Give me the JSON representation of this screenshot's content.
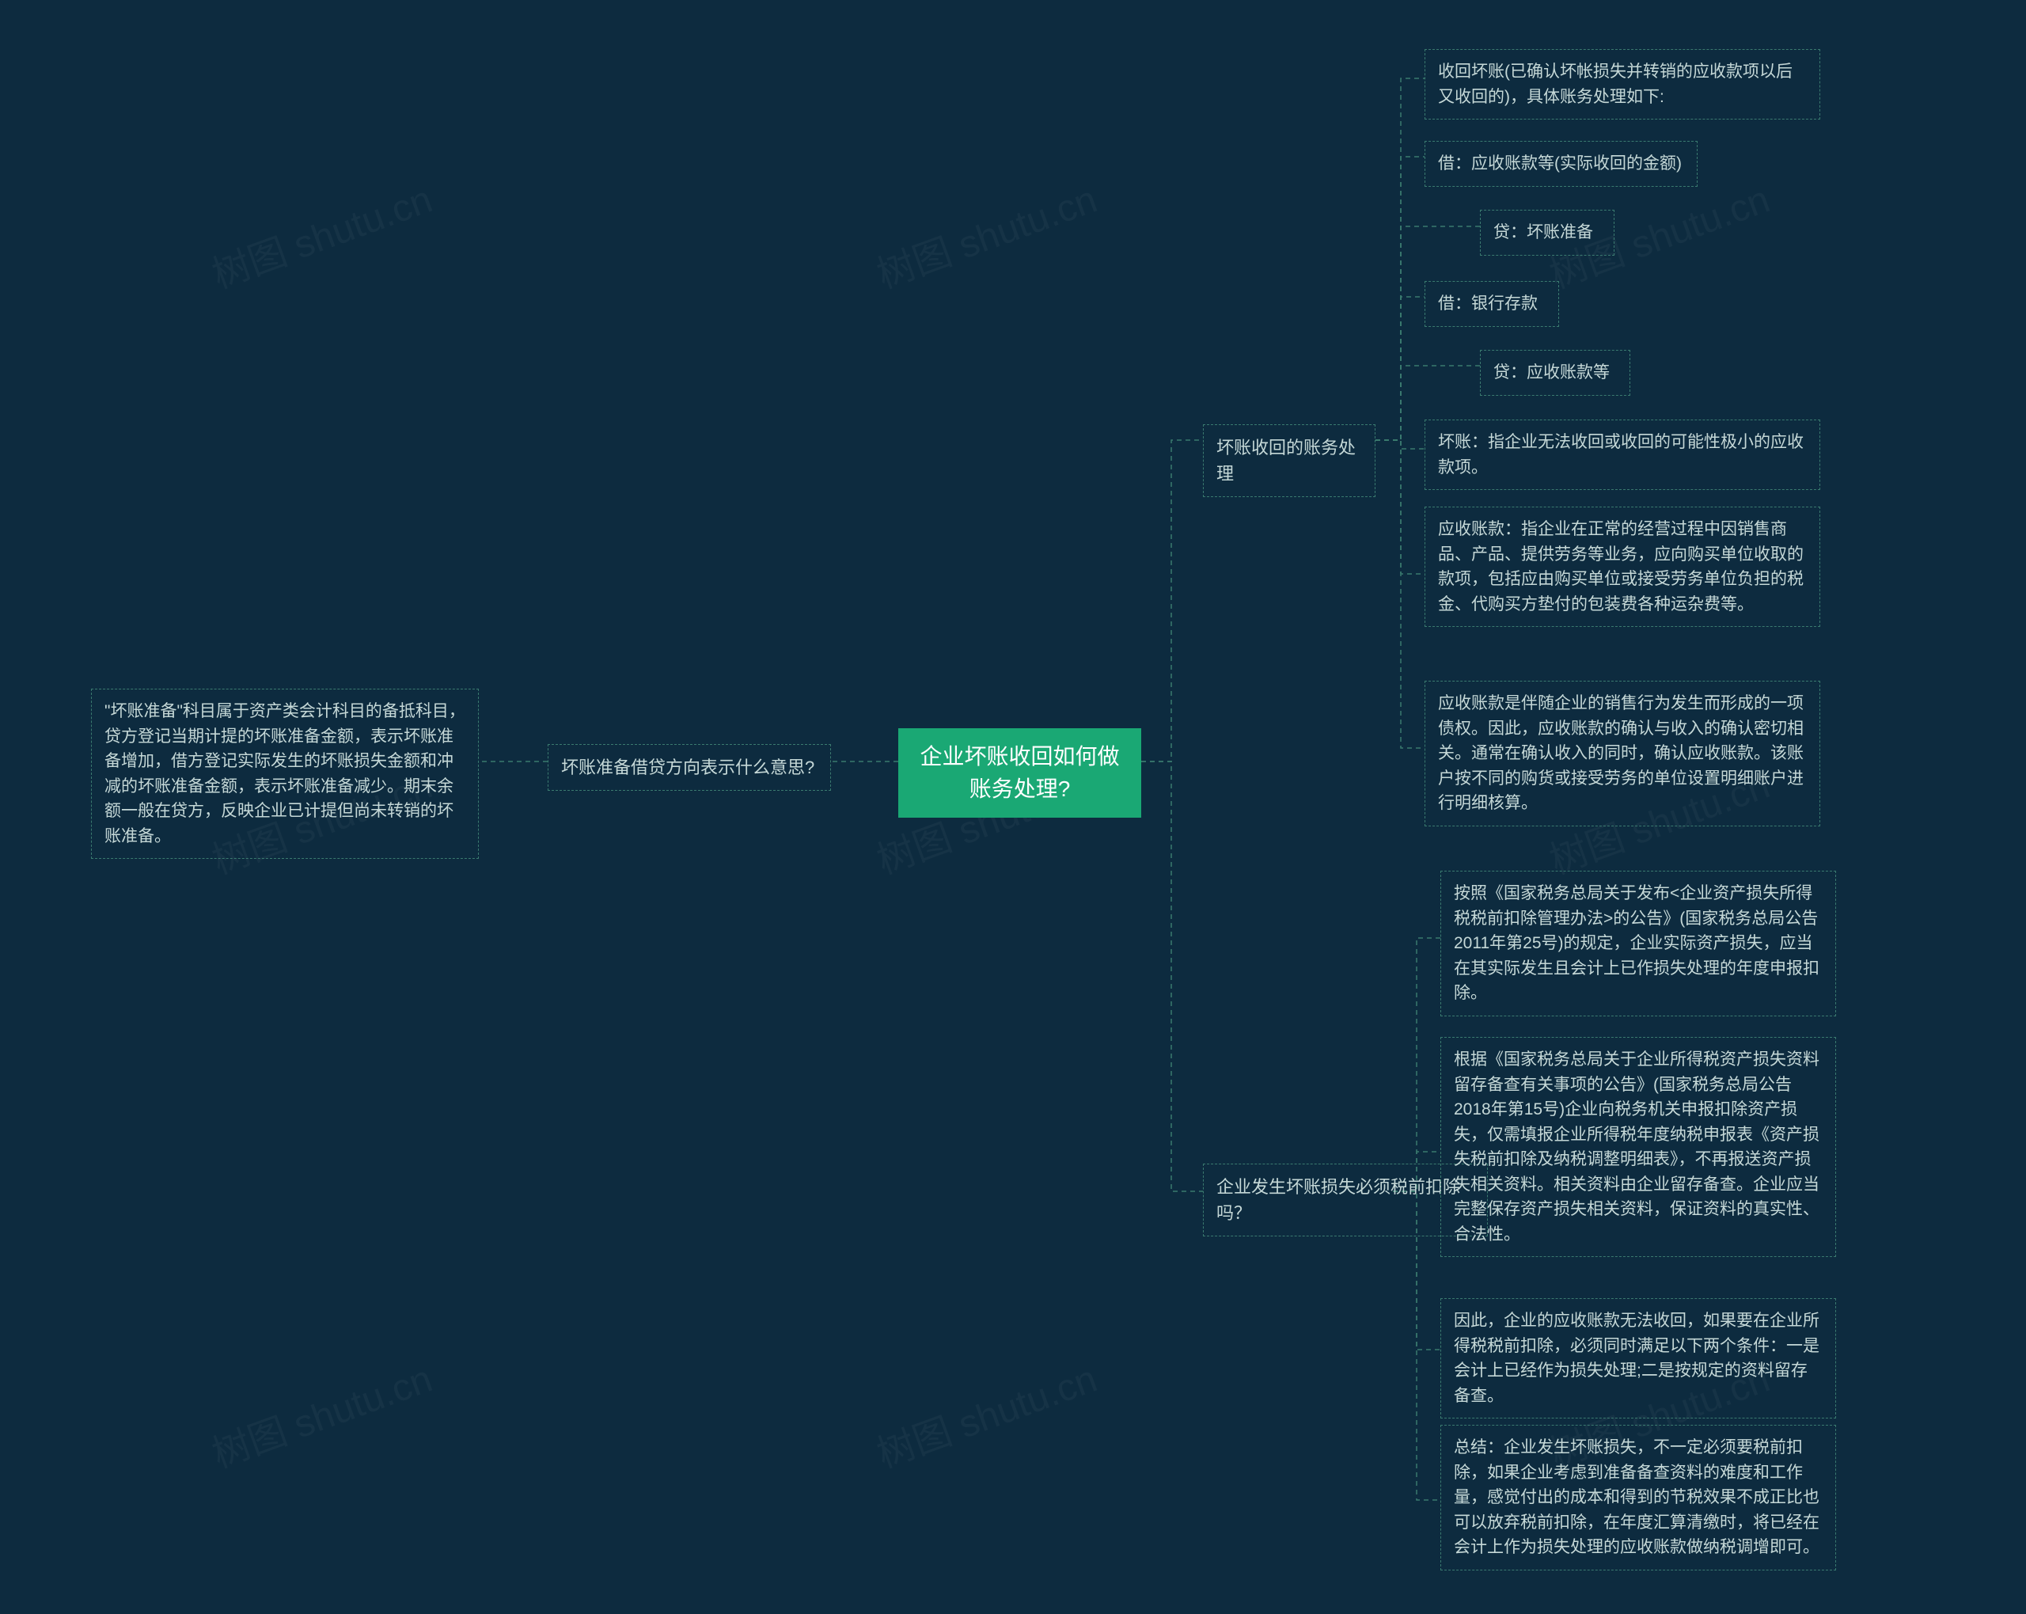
{
  "watermark": "树图 shutu.cn",
  "root": "企业坏账收回如何做账务处理?",
  "left": {
    "branch": "坏账准备借贷方向表示什么意思?",
    "leaf": "\"坏账准备\"科目属于资产类会计科目的备抵科目，贷方登记当期计提的坏账准备金额，表示坏账准备增加，借方登记实际发生的坏账损失金额和冲减的坏账准备金额，表示坏账准备减少。期末余额一般在贷方，反映企业已计提但尚未转销的坏账准备。"
  },
  "right": {
    "branch1": {
      "title": "坏账收回的账务处理",
      "items": [
        "收回坏账(已确认坏帐损失并转销的应收款项以后又收回的)，具体账务处理如下:",
        "借：应收账款等(实际收回的金额)",
        "贷：坏账准备",
        "借：银行存款",
        "贷：应收账款等",
        "坏账：指企业无法收回或收回的可能性极小的应收款项。",
        "应收账款：指企业在正常的经营过程中因销售商品、产品、提供劳务等业务，应向购买单位收取的款项，包括应由购买单位或接受劳务单位负担的税金、代购买方垫付的包装费各种运杂费等。",
        "应收账款是伴随企业的销售行为发生而形成的一项债权。因此，应收账款的确认与收入的确认密切相关。通常在确认收入的同时，确认应收账款。该账户按不同的购货或接受劳务的单位设置明细账户进行明细核算。"
      ]
    },
    "branch2": {
      "title": "企业发生坏账损失必须税前扣除吗？",
      "items": [
        "按照《国家税务总局关于发布<企业资产损失所得税税前扣除管理办法>的公告》(国家税务总局公告2011年第25号)的规定，企业实际资产损失，应当在其实际发生且会计上已作损失处理的年度申报扣除。",
        "根据《国家税务总局关于企业所得税资产损失资料留存备查有关事项的公告》(国家税务总局公告2018年第15号)企业向税务机关申报扣除资产损失，仅需填报企业所得税年度纳税申报表《资产损失税前扣除及纳税调整明细表》，不再报送资产损失相关资料。相关资料由企业留存备查。企业应当完整保存资产损失相关资料，保证资料的真实性、合法性。",
        "因此，企业的应收账款无法收回，如果要在企业所得税税前扣除，必须同时满足以下两个条件：一是会计上已经作为损失处理;二是按规定的资料留存备查。",
        "总结：企业发生坏账损失，不一定必须要税前扣除，如果企业考虑到准备备查资料的难度和工作量，感觉付出的成本和得到的节税效果不成正比也可以放弃税前扣除，在年度汇算清缴时，将已经在会计上作为损失处理的应收账款做纳税调增即可。"
      ]
    }
  }
}
